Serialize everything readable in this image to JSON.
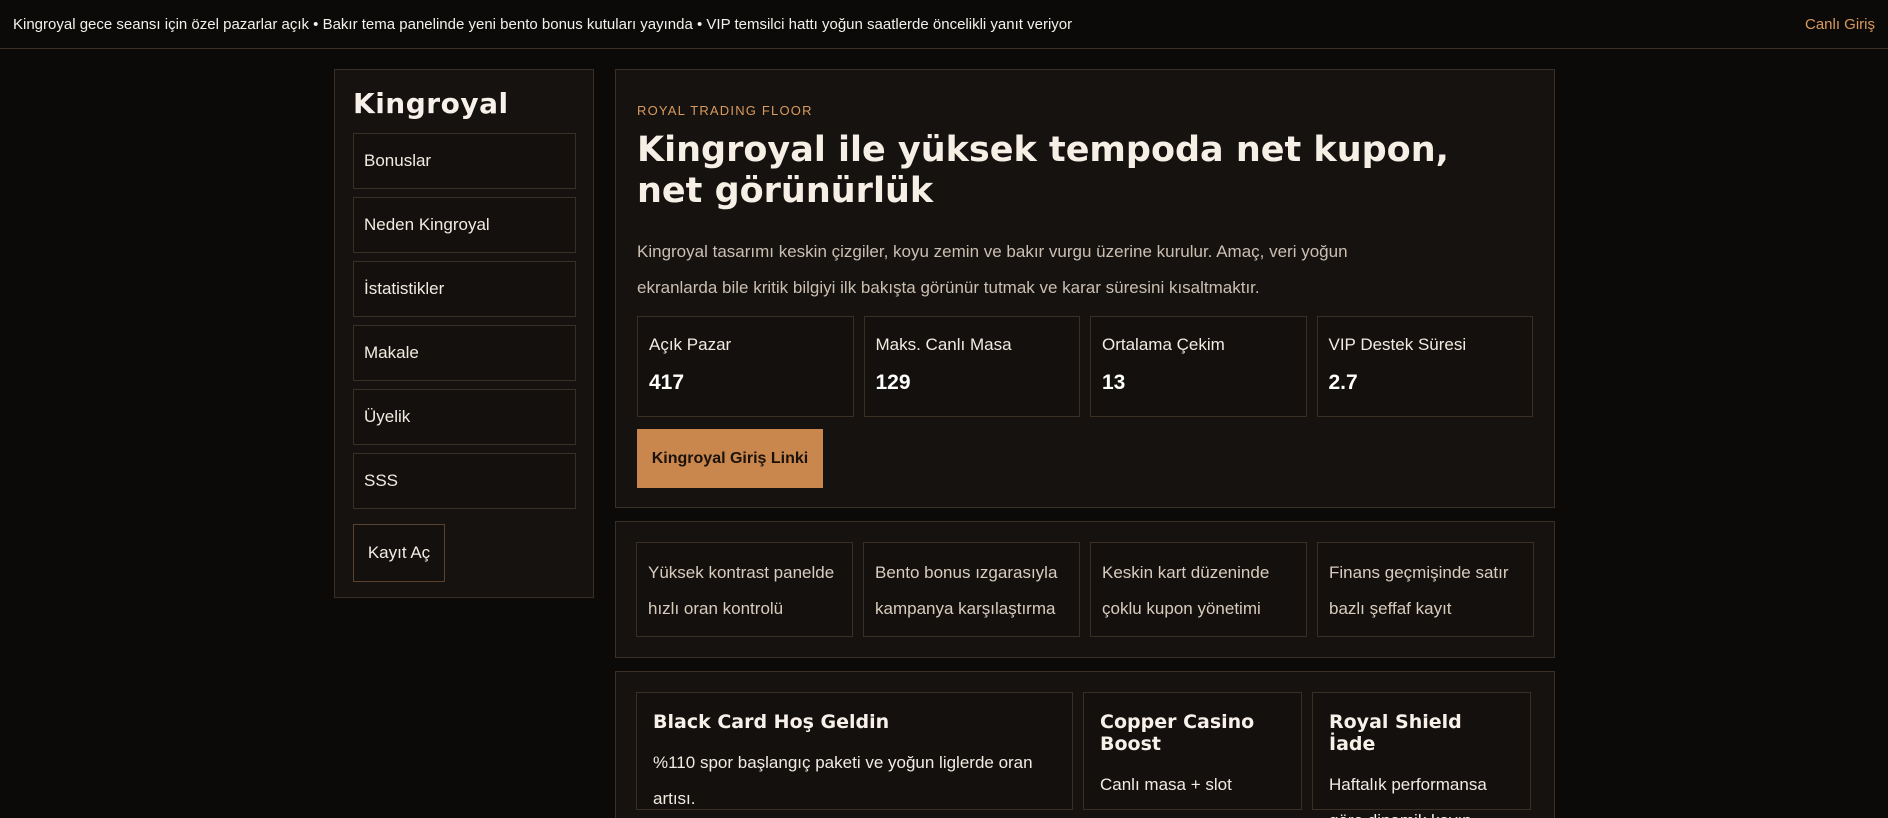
{
  "topbar": {
    "ticker": "Kingroyal gece seansı için özel pazarlar açık • Bakır tema panelinde yeni bento bonus kutuları yayında • VIP temsilci hattı yoğun saatlerde öncelikli yanıt veriyor",
    "live_login": "Canlı Giriş"
  },
  "sidebar": {
    "logo": "Kingroyal",
    "items": [
      {
        "label": "Bonuslar"
      },
      {
        "label": "Neden Kingroyal"
      },
      {
        "label": "İstatistikler"
      },
      {
        "label": "Makale"
      },
      {
        "label": "Üyelik"
      },
      {
        "label": "SSS"
      }
    ],
    "signup": "Kayıt Aç"
  },
  "hero": {
    "eyebrow": "ROYAL TRADING FLOOR",
    "title": "Kingroyal ile yüksek tempoda net kupon, net görünürlük",
    "description": "Kingroyal tasarımı keskin çizgiler, koyu zemin ve bakır vurgu üzerine kurulur. Amaç, veri yoğun ekranlarda bile kritik bilgiyi ilk bakışta görünür tutmak ve karar süresini kısaltmaktır.",
    "stats": [
      {
        "label": "Açık Pazar",
        "value": "417"
      },
      {
        "label": "Maks. Canlı Masa",
        "value": "129"
      },
      {
        "label": "Ortalama Çekim",
        "value": "13"
      },
      {
        "label": "VIP Destek Süresi",
        "value": "2.7"
      }
    ],
    "cta": "Kingroyal Giriş Linki"
  },
  "features": [
    {
      "text": "Yüksek kontrast panelde hızlı oran kontrolü"
    },
    {
      "text": "Bento bonus ızgarasıyla kampanya karşılaştırma"
    },
    {
      "text": "Keskin kart düzeninde çoklu kupon yönetimi"
    },
    {
      "text": "Finans geçmişinde satır bazlı şeffaf kayıt"
    }
  ],
  "bonuses": [
    {
      "title": "Black Card Hoş Geldin",
      "text": "%110 spor başlangıç paketi ve yoğun liglerde oran artısı."
    },
    {
      "title": "Copper Casino Boost",
      "text": "Canlı masa + slot"
    },
    {
      "title": "Royal Shield İade",
      "text": "Haftalık performansa göre dinamik kayıp"
    }
  ],
  "colors": {
    "accent": "#c9874d",
    "accent_text": "#d99a5f",
    "background": "#0b0a09",
    "panel": "#15120f",
    "border": "#3a2f25"
  }
}
